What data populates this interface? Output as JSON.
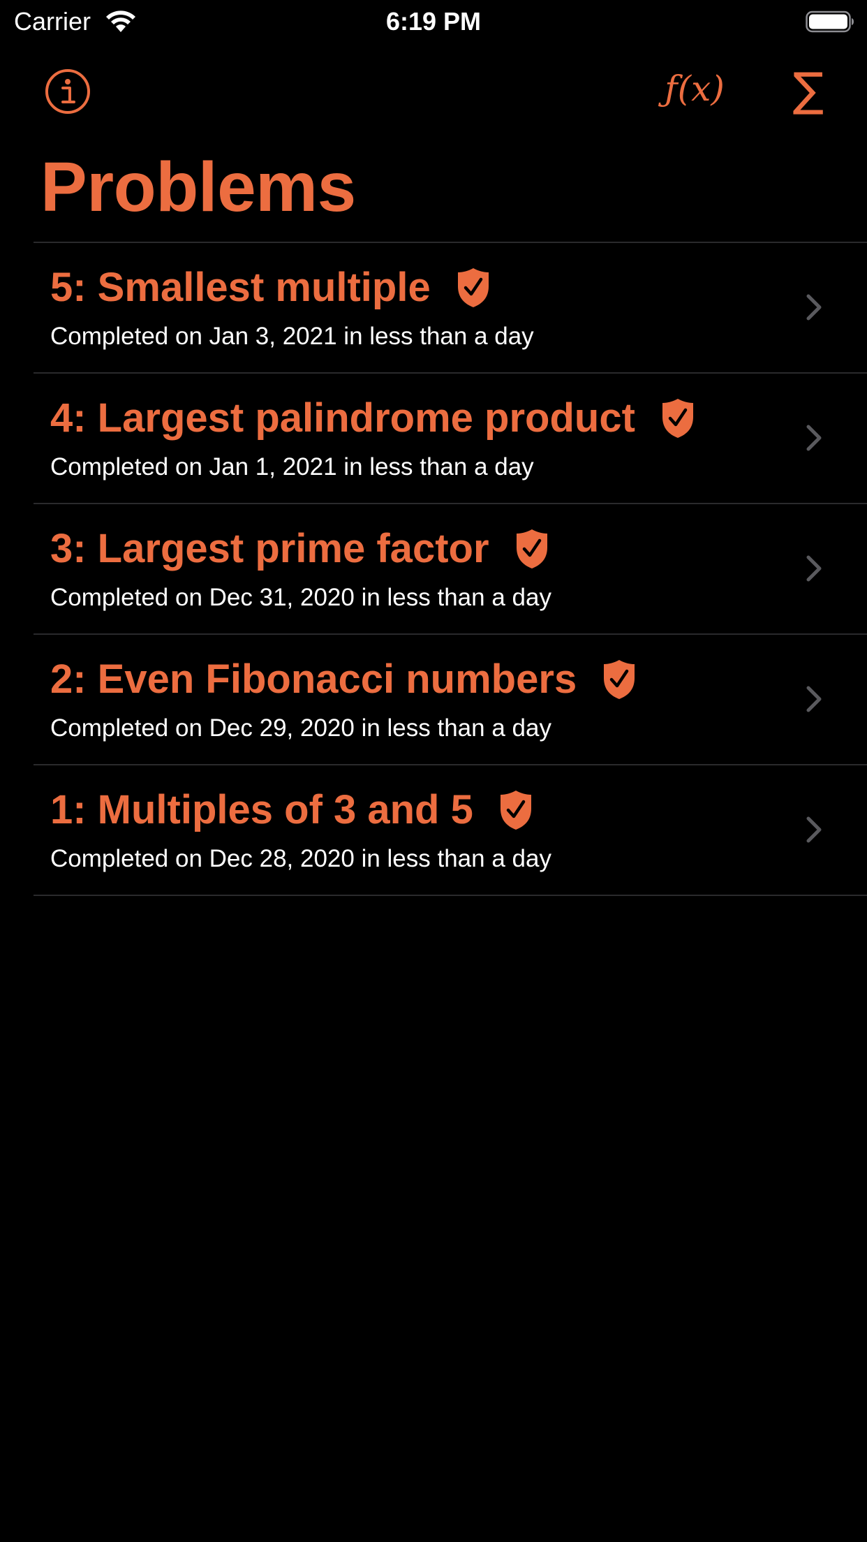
{
  "status_bar": {
    "carrier": "Carrier",
    "time": "6:19 PM"
  },
  "nav": {
    "title": "Problems",
    "fx_label": "ƒ(x)",
    "sum_label": "∑"
  },
  "colors": {
    "accent": "#ec6d40",
    "background": "#000000",
    "separator": "#2a2a2c",
    "chevron": "#5a5a5e"
  },
  "problems": [
    {
      "title": "5: Smallest multiple",
      "subtitle": "Completed on Jan 3, 2021 in less than a day",
      "icon": "shield-check-icon"
    },
    {
      "title": "4: Largest palindrome product",
      "subtitle": "Completed on Jan 1, 2021 in less than a day",
      "icon": "shield-check-icon"
    },
    {
      "title": "3: Largest prime factor",
      "subtitle": "Completed on Dec 31, 2020 in less than a day",
      "icon": "shield-check-icon"
    },
    {
      "title": "2: Even Fibonacci numbers",
      "subtitle": "Completed on Dec 29, 2020 in less than a day",
      "icon": "shield-check-icon"
    },
    {
      "title": "1: Multiples of 3 and 5",
      "subtitle": "Completed on Dec 28, 2020 in less than a day",
      "icon": "shield-check-icon"
    }
  ]
}
